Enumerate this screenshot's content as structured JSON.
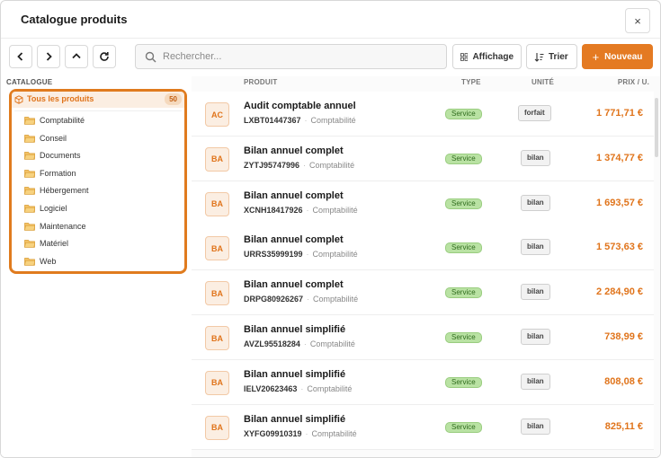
{
  "window": {
    "title": "Catalogue produits",
    "close_label": "×"
  },
  "toolbar": {
    "search_placeholder": "Rechercher...",
    "display_label": "Affichage",
    "sort_label": "Trier",
    "new_label": "Nouveau"
  },
  "sidebar": {
    "section_label": "CATALOGUE",
    "all_label": "Tous les produits",
    "all_count": "50",
    "categories": [
      "Comptabilité",
      "Conseil",
      "Documents",
      "Formation",
      "Hébergement",
      "Logiciel",
      "Maintenance",
      "Matériel",
      "Web"
    ]
  },
  "table": {
    "headers": {
      "product": "PRODUIT",
      "type": "TYPE",
      "unit": "UNITÉ",
      "price": "PRIX / U."
    },
    "rows": [
      {
        "initials": "AC",
        "name": "Audit comptable annuel",
        "code": "LXBT01447367",
        "category": "Comptabilité",
        "type": "Service",
        "unit": "forfait",
        "price": "1 771,71 €"
      },
      {
        "initials": "BA",
        "name": "Bilan annuel complet",
        "code": "ZYTJ95747996",
        "category": "Comptabilité",
        "type": "Service",
        "unit": "bilan",
        "price": "1 374,77 €"
      },
      {
        "initials": "BA",
        "name": "Bilan annuel complet",
        "code": "XCNH18417926",
        "category": "Comptabilité",
        "type": "Service",
        "unit": "bilan",
        "price": "1 693,57 €"
      },
      {
        "initials": "BA",
        "name": "Bilan annuel complet",
        "code": "URRS35999199",
        "category": "Comptabilité",
        "type": "Service",
        "unit": "bilan",
        "price": "1 573,63 €"
      },
      {
        "initials": "BA",
        "name": "Bilan annuel complet",
        "code": "DRPG80926267",
        "category": "Comptabilité",
        "type": "Service",
        "unit": "bilan",
        "price": "2 284,90 €"
      },
      {
        "initials": "BA",
        "name": "Bilan annuel simplifié",
        "code": "AVZL95518284",
        "category": "Comptabilité",
        "type": "Service",
        "unit": "bilan",
        "price": "738,99 €"
      },
      {
        "initials": "BA",
        "name": "Bilan annuel simplifié",
        "code": "IELV20623463",
        "category": "Comptabilité",
        "type": "Service",
        "unit": "bilan",
        "price": "808,08 €"
      },
      {
        "initials": "BA",
        "name": "Bilan annuel simplifié",
        "code": "XYFG09910319",
        "category": "Comptabilité",
        "type": "Service",
        "unit": "bilan",
        "price": "825,11 €"
      }
    ]
  },
  "colors": {
    "accent": "#e47a22",
    "service_badge": "#b9e2a3"
  }
}
